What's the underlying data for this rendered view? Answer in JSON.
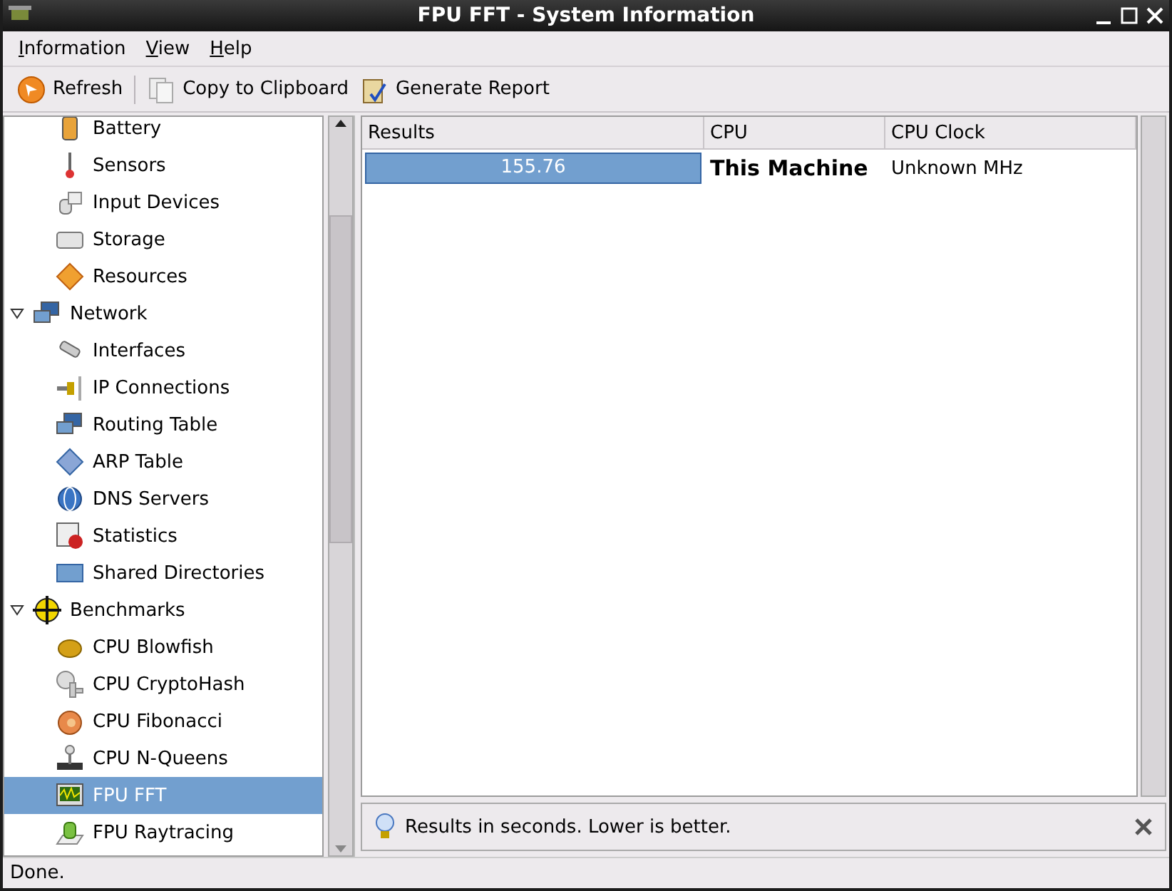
{
  "window": {
    "title": "FPU FFT - System Information"
  },
  "menu": [
    "Information",
    "View",
    "Help"
  ],
  "toolbar": [
    {
      "kind": "refresh",
      "label": "Refresh"
    },
    {
      "kind": "copy",
      "label": "Copy to Clipboard"
    },
    {
      "kind": "report",
      "label": "Generate Report"
    }
  ],
  "tree": [
    {
      "children": [
        {
          "label": "Battery",
          "selected": false
        },
        {
          "label": "Sensors",
          "selected": false
        },
        {
          "label": "Input Devices",
          "selected": false
        },
        {
          "label": "Storage",
          "selected": false
        },
        {
          "label": "Resources",
          "selected": false
        }
      ]
    },
    {
      "label": "Network",
      "selected": false,
      "expanded": true,
      "children": [
        {
          "label": "Interfaces",
          "selected": false
        },
        {
          "label": "IP Connections",
          "selected": false
        },
        {
          "label": "Routing Table",
          "selected": false
        },
        {
          "label": "ARP Table",
          "selected": false
        },
        {
          "label": "DNS Servers",
          "selected": false
        },
        {
          "label": "Statistics",
          "selected": false
        },
        {
          "label": "Shared Directories",
          "selected": false
        }
      ]
    },
    {
      "label": "Benchmarks",
      "selected": false,
      "expanded": true,
      "children": [
        {
          "label": "CPU Blowfish",
          "selected": false
        },
        {
          "label": "CPU CryptoHash",
          "selected": false
        },
        {
          "label": "CPU Fibonacci",
          "selected": false
        },
        {
          "label": "CPU N-Queens",
          "selected": false
        },
        {
          "label": "FPU FFT",
          "selected": true
        },
        {
          "label": "FPU Raytracing",
          "selected": false
        }
      ]
    }
  ],
  "table": {
    "columns": [
      "Results",
      "CPU",
      "CPU Clock"
    ],
    "rows": [
      {
        "result": "155.76",
        "level": 1,
        "cpu": "This Machine",
        "clock": "Unknown MHz"
      }
    ]
  },
  "note": "Results in seconds. Lower is better.",
  "status_bar": "Done."
}
